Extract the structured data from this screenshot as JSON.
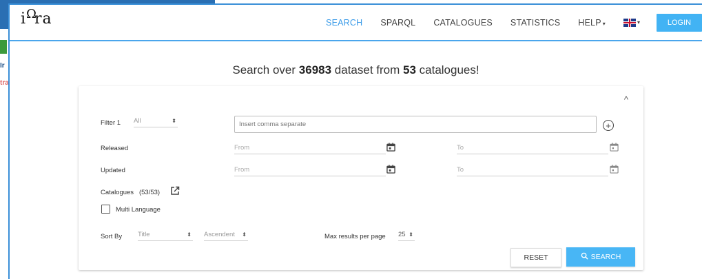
{
  "background": {
    "left_text_1": "Ir",
    "left_text_2": "tra"
  },
  "brand": {
    "logo_text": "iΩra"
  },
  "nav": {
    "items": [
      {
        "label": "SEARCH",
        "active": true
      },
      {
        "label": "SPARQL"
      },
      {
        "label": "CATALOGUES"
      },
      {
        "label": "STATISTICS"
      },
      {
        "label": "HELP"
      }
    ],
    "help_caret": "▾",
    "language_icon": "uk-flag-icon",
    "language_caret": "▾",
    "login_label": "LOGIN"
  },
  "headline": {
    "prefix": "Search over ",
    "dataset_count": "36983",
    "middle": " dataset from ",
    "catalogue_count": "53",
    "suffix": " catalogues!"
  },
  "form": {
    "collapse_icon": "^",
    "filter": {
      "label": "Filter 1",
      "select_value": "All",
      "keywords_placeholder": "Insert comma separated keywords",
      "keywords_visible": "Insert comma separate",
      "add_icon": "+"
    },
    "released": {
      "label": "Released",
      "from_placeholder": "From",
      "to_placeholder": "To"
    },
    "updated": {
      "label": "Updated",
      "from_placeholder": "From",
      "to_placeholder": "To"
    },
    "catalogues": {
      "label": "Catalogues",
      "count": "(53/53)"
    },
    "multi_language": {
      "label": "Multi Language",
      "checked": false
    },
    "sort": {
      "label": "Sort By",
      "field_value": "Title",
      "order_value": "Ascendent"
    },
    "max_results": {
      "label": "Max results per page",
      "value": "25"
    },
    "reset_label": "RESET",
    "search_label": "SEARCH"
  },
  "colors": {
    "accent": "#42b3f4",
    "active_nav": "#3a9be8",
    "frame": "#3a8fd8"
  }
}
